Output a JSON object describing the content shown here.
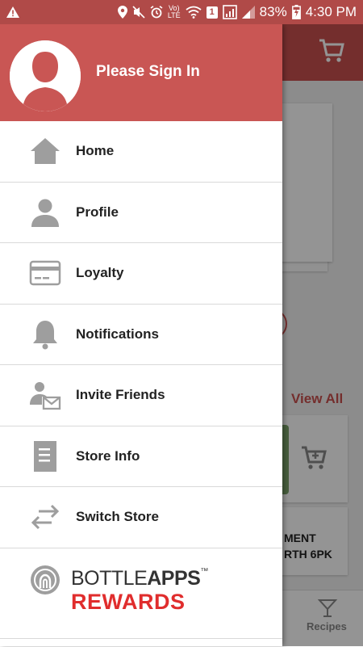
{
  "status_bar": {
    "battery": "83%",
    "time": "4:30 PM",
    "notif_count": "1",
    "network": "LTE"
  },
  "background": {
    "view_all": "View All",
    "product_line1": "MENT",
    "product_line2": "RTH 6PK",
    "bottom_tab": "Recipes"
  },
  "drawer": {
    "header": {
      "signin": "Please Sign In"
    },
    "menu": [
      {
        "label": "Home",
        "icon": "home-icon"
      },
      {
        "label": "Profile",
        "icon": "profile-icon"
      },
      {
        "label": "Loyalty",
        "icon": "card-icon"
      },
      {
        "label": "Notifications",
        "icon": "bell-icon"
      },
      {
        "label": "Invite Friends",
        "icon": "invite-icon"
      },
      {
        "label": "Store Info",
        "icon": "document-icon"
      },
      {
        "label": "Switch Store",
        "icon": "swap-icon"
      }
    ],
    "brand": {
      "top_left": "BOTTLE",
      "top_right": "APPS",
      "tm": "™",
      "bottom": "REWARDS"
    }
  },
  "colors": {
    "header_red": "#c95654",
    "accent_red": "#e02d2d",
    "icon_gray": "#9e9e9e"
  }
}
